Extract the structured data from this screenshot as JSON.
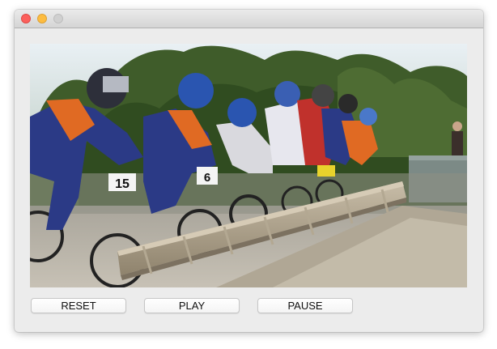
{
  "window": {
    "traffic_lights": {
      "close": "#fc605c",
      "minimize": "#fdbc40",
      "zoom": "#d0d0d0"
    }
  },
  "video": {
    "content": "bmx-race-start-gate-frame"
  },
  "controls": {
    "reset_label": "RESET",
    "play_label": "PLAY",
    "pause_label": "PAUSE"
  },
  "plates": {
    "rider_2": "15",
    "rider_3": "6"
  }
}
